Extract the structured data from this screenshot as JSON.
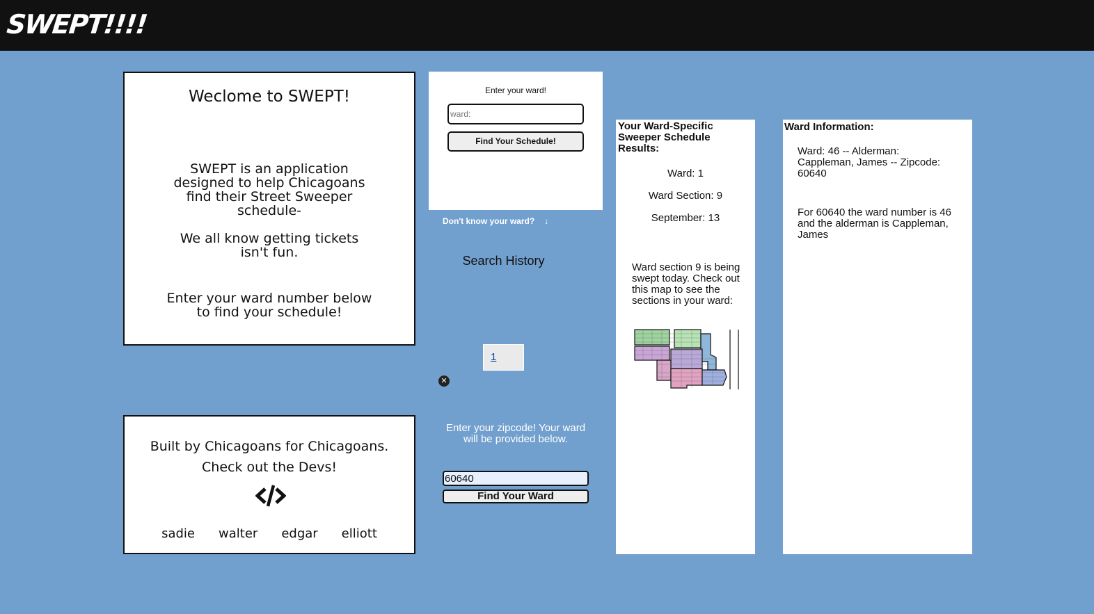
{
  "header": {
    "logo": "SWEPT!!!!"
  },
  "welcome": {
    "title": "Weclome to SWEPT!",
    "paragraph1": "SWEPT is an application designed to help Chicagoans find their Street Sweeper schedule-",
    "paragraph2": "We all know getting tickets isn't fun.",
    "paragraph3": "Enter your ward number below to find your schedule!"
  },
  "devs": {
    "line1": "Built by Chicagoans for Chicagoans.",
    "line2": "Check out the Devs!",
    "icon": "code-icon",
    "names": [
      "sadie",
      "walter",
      "edgar",
      "elliott"
    ]
  },
  "ward_form": {
    "prompt": "Enter your ward!",
    "placeholder": "ward:",
    "value": "",
    "button": "Find Your Schedule!"
  },
  "dont_know": {
    "label": "Don't know your ward?",
    "icon": "arrow-down-icon"
  },
  "search_history": {
    "title": "Search History",
    "items": [
      "1"
    ],
    "clear_icon": "close-circle-icon"
  },
  "zip_form": {
    "prompt": "Enter your zipcode! Your ward will be provided below.",
    "value": "60640",
    "button": "Find Your Ward"
  },
  "results": {
    "heading": "Your Ward-Specific Sweeper Schedule Results:",
    "ward": "Ward: 1",
    "section": "Ward Section: 9",
    "date": "September: 13",
    "message": "Ward section 9 is being swept today. Check out this map to see the sections in your ward:"
  },
  "ward_info": {
    "heading": "Ward Information:",
    "summary": "Ward: 46 -- Alderman: Cappleman, James -- Zipcode: 60640",
    "detail": "For 60640 the ward number is 46 and the alderman is Cappleman, James"
  },
  "colors": {
    "background": "#72a0ce",
    "header": "#111111",
    "panel": "#ffffff"
  }
}
